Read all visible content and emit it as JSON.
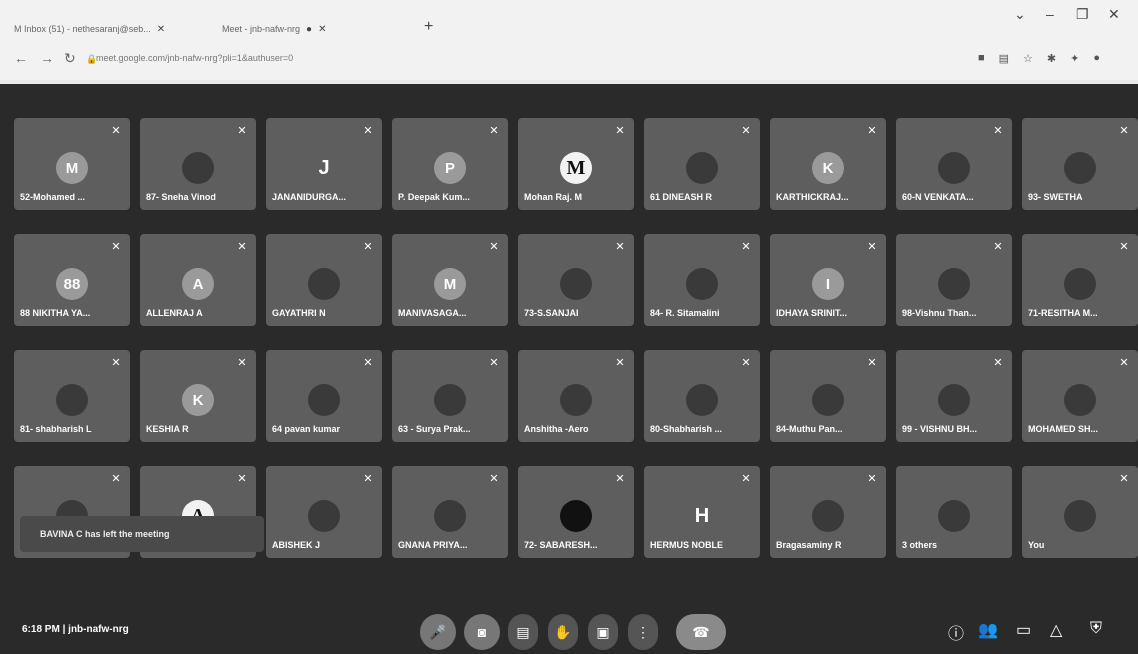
{
  "browser": {
    "tabs": [
      {
        "label": "M  Inbox (51) - nethesaranj@seb..."
      },
      {
        "label": "Meet - jnb-nafw-nrg"
      }
    ],
    "url": "meet.google.com/jnb-nafw-nrg?pli=1&authuser=0"
  },
  "tiles": [
    {
      "name": "52-Mohamed ...",
      "avatar_letter": "M",
      "avatar": "letter"
    },
    {
      "name": "87- Sneha Vinod",
      "avatar_letter": "",
      "avatar": "photo"
    },
    {
      "name": "JANANIDURGA...",
      "avatar_letter": "J",
      "avatar": "plain"
    },
    {
      "name": "P. Deepak Kum...",
      "avatar_letter": "P",
      "avatar": "letter"
    },
    {
      "name": "Mohan Raj. M",
      "avatar_letter": "M",
      "avatar": "white"
    },
    {
      "name": "61 DINEASH R",
      "avatar_letter": "",
      "avatar": "photo"
    },
    {
      "name": "KARTHICKRAJ...",
      "avatar_letter": "K",
      "avatar": "letter"
    },
    {
      "name": "60-N VENKATA...",
      "avatar_letter": "",
      "avatar": "photo"
    },
    {
      "name": "93- SWETHA",
      "avatar_letter": "",
      "avatar": "photo"
    },
    {
      "name": "88 NIKITHA YA...",
      "avatar_letter": "88",
      "avatar": "letter"
    },
    {
      "name": "ALLENRAJ A",
      "avatar_letter": "A",
      "avatar": "letter"
    },
    {
      "name": "GAYATHRI N",
      "avatar_letter": "",
      "avatar": "photo"
    },
    {
      "name": "MANIVASAGA...",
      "avatar_letter": "M",
      "avatar": "letter"
    },
    {
      "name": "73-S.SANJAI",
      "avatar_letter": "",
      "avatar": "photo"
    },
    {
      "name": "84- R. Sitamalini",
      "avatar_letter": "",
      "avatar": "photo"
    },
    {
      "name": "IDHAYA SRINIT...",
      "avatar_letter": "I",
      "avatar": "letter"
    },
    {
      "name": "98-Vishnu Than...",
      "avatar_letter": "",
      "avatar": "photo"
    },
    {
      "name": "71-RESITHA M...",
      "avatar_letter": "",
      "avatar": "photo"
    },
    {
      "name": "81- shabharish L",
      "avatar_letter": "",
      "avatar": "photo"
    },
    {
      "name": "KESHIA R",
      "avatar_letter": "K",
      "avatar": "letter"
    },
    {
      "name": "64 pavan kumar",
      "avatar_letter": "",
      "avatar": "photo"
    },
    {
      "name": "63 - Surya Prak...",
      "avatar_letter": "",
      "avatar": "photo"
    },
    {
      "name": "Anshitha -Aero",
      "avatar_letter": "",
      "avatar": "photo"
    },
    {
      "name": "80-Shabharish ...",
      "avatar_letter": "",
      "avatar": "photo"
    },
    {
      "name": "84-Muthu Pan...",
      "avatar_letter": "",
      "avatar": "photo"
    },
    {
      "name": "99 - VISHNU BH...",
      "avatar_letter": "",
      "avatar": "photo"
    },
    {
      "name": "MOHAMED SH...",
      "avatar_letter": "",
      "avatar": "photo"
    },
    {
      "name": "",
      "avatar_letter": "",
      "avatar": "photo"
    },
    {
      "name": "",
      "avatar_letter": "A",
      "avatar": "white"
    },
    {
      "name": "ABISHEK J",
      "avatar_letter": "",
      "avatar": "photo"
    },
    {
      "name": "GNANA PRIYA...",
      "avatar_letter": "",
      "avatar": "photo"
    },
    {
      "name": "72- SABARESH...",
      "avatar_letter": "",
      "avatar": "dark"
    },
    {
      "name": "HERMUS NOBLE",
      "avatar_letter": "H",
      "avatar": "plain"
    },
    {
      "name": "Bragasaminy R",
      "avatar_letter": "",
      "avatar": "photo"
    },
    {
      "name": "3 others",
      "avatar_letter": "",
      "avatar": "photo"
    },
    {
      "name": "You",
      "avatar_letter": "",
      "avatar": "photo"
    }
  ],
  "toast": "BAVINA C has left the meeting",
  "footer": {
    "time": "6:18 PM",
    "separator": "|",
    "meeting_code": "jnb-nafw-nrg"
  }
}
